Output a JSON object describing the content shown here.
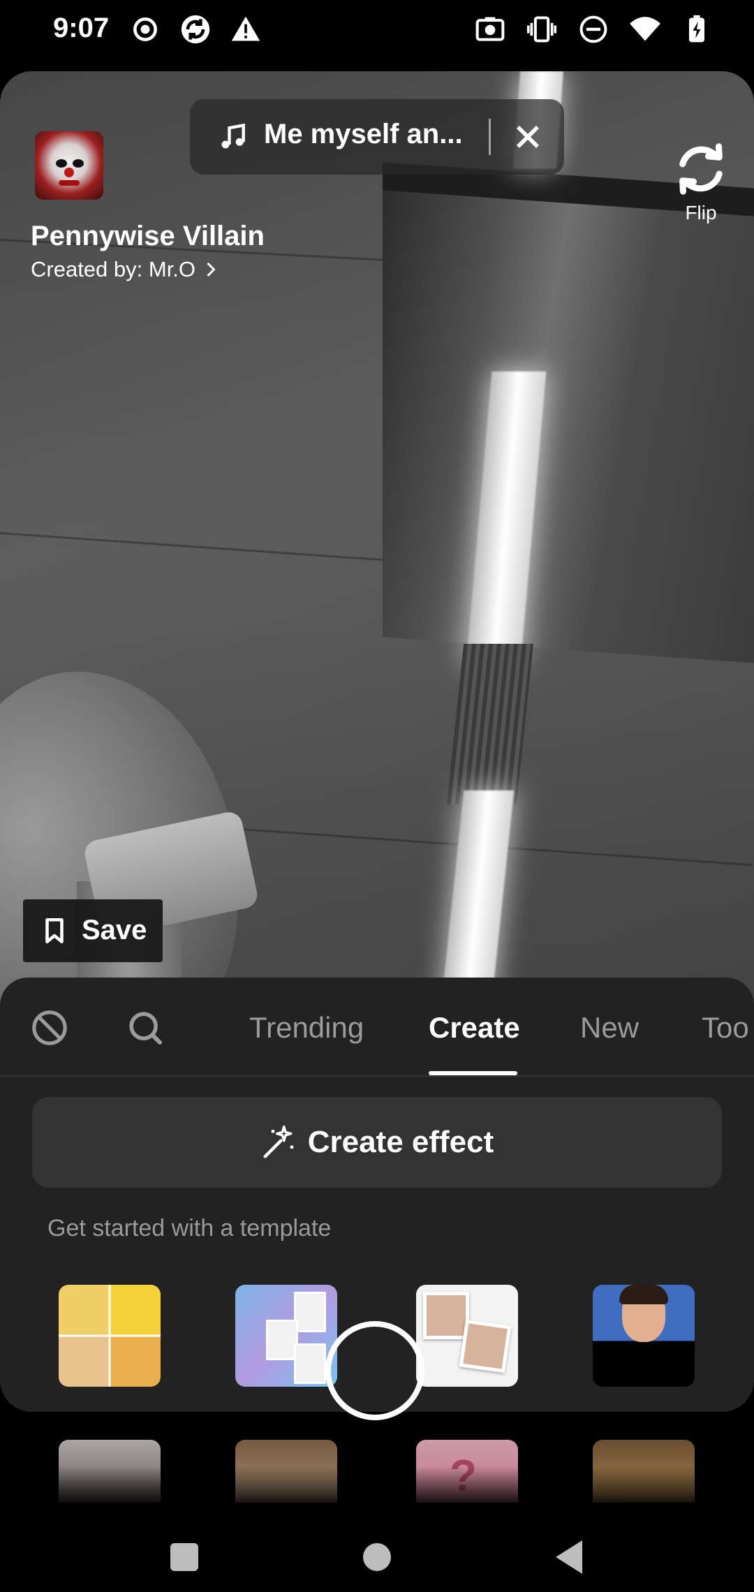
{
  "status_bar": {
    "time": "9:07",
    "left_icons": [
      "record-icon",
      "sync-icon",
      "warning-icon"
    ],
    "right_icons": [
      "screenshot-icon",
      "vibrate-icon",
      "dnd-icon",
      "wifi-icon",
      "battery-charging-icon"
    ]
  },
  "music": {
    "title": "Me myself an...",
    "note_icon": "music-note-icon",
    "close_icon": "close-icon"
  },
  "effect": {
    "name": "Pennywise Villain",
    "creator": "Created by: Mr.O"
  },
  "flip": {
    "label": "Flip",
    "icon": "flip-camera-icon"
  },
  "save": {
    "label": "Save",
    "icon": "bookmark-icon"
  },
  "tabs": {
    "no_effect_icon": "no-effect-icon",
    "search_icon": "search-icon",
    "items": [
      {
        "label": "Trending",
        "active": false
      },
      {
        "label": "Create",
        "active": true
      },
      {
        "label": "New",
        "active": false
      },
      {
        "label": "Too",
        "active": false
      }
    ]
  },
  "create_effect": {
    "label": "Create effect",
    "icon": "magic-wand-icon"
  },
  "template_hint": "Get started with a template",
  "templates_row1": [
    "minion-collage-template",
    "polaroid-characters-template",
    "photo-collage-template",
    "face-portrait-template"
  ],
  "templates_row2": [
    "portrait-template",
    "glasses-template",
    "mystery-template",
    "chocolate-template"
  ],
  "colors": {
    "panel_bg": "#222222",
    "create_button_bg": "#333333",
    "inactive_tab": "#9b9b9b"
  }
}
